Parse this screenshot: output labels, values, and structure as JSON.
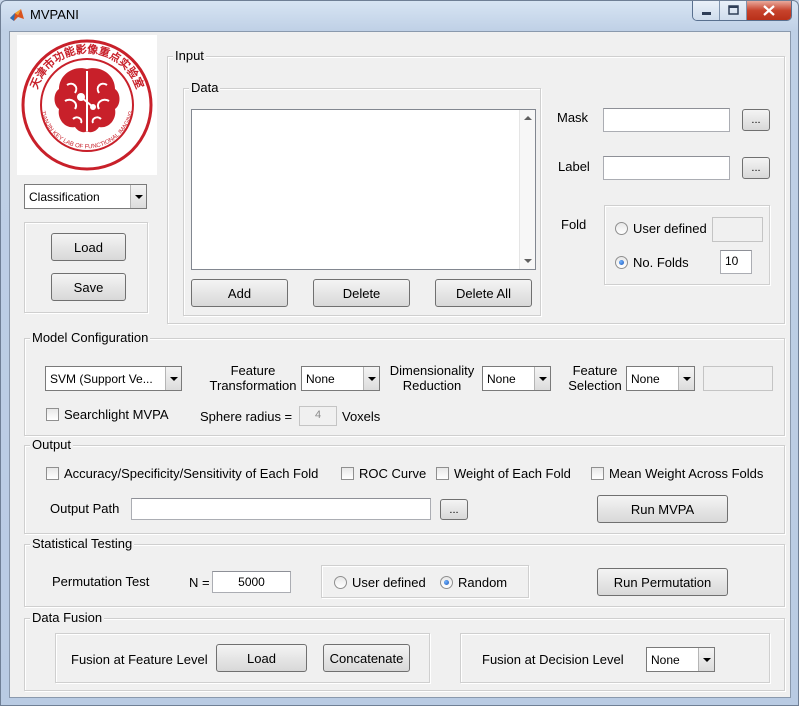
{
  "window": {
    "title": "MVPANI"
  },
  "logo": {
    "text_top": "天津市功能影像重点实验室",
    "text_bottom": "TIANJIN KEY LAB OF FUNCTIONAL IMAGING"
  },
  "mode_select": {
    "value": "Classification"
  },
  "side_buttons": {
    "load": "Load",
    "save": "Save"
  },
  "input": {
    "title": "Input",
    "data": {
      "title": "Data",
      "add": "Add",
      "delete": "Delete",
      "delete_all": "Delete All"
    },
    "mask": {
      "label": "Mask",
      "value": "",
      "browse": "..."
    },
    "label": {
      "label": "Label",
      "value": "",
      "browse": "..."
    },
    "fold": {
      "label": "Fold",
      "user_defined": "User defined",
      "user_defined_value": "",
      "no_folds": "No. Folds",
      "no_folds_value": "10",
      "selected": "no_folds"
    }
  },
  "model_config": {
    "title": "Model Configuration",
    "classifier": "SVM (Support Ve...",
    "feature_transformation": {
      "label_line1": "Feature",
      "label_line2": "Transformation",
      "value": "None"
    },
    "dimensionality_reduction": {
      "label_line1": "Dimensionality",
      "label_line2": "Reduction",
      "value": "None"
    },
    "feature_selection": {
      "label_line1": "Feature",
      "label_line2": "Selection",
      "value": "None",
      "param": ""
    },
    "searchlight": {
      "label": "Searchlight MVPA",
      "checked": false
    },
    "sphere_radius": {
      "label": "Sphere radius =",
      "value": "4",
      "unit": "Voxels"
    }
  },
  "output": {
    "title": "Output",
    "options": [
      {
        "label": "Accuracy/Specificity/Sensitivity of Each Fold",
        "checked": false
      },
      {
        "label": "ROC Curve",
        "checked": false
      },
      {
        "label": "Weight of Each Fold",
        "checked": false
      },
      {
        "label": "Mean Weight Across Folds",
        "checked": false
      }
    ],
    "path_label": "Output Path",
    "path_value": "",
    "browse": "...",
    "run": "Run MVPA"
  },
  "stats": {
    "title": "Statistical Testing",
    "permutation_label": "Permutation Test",
    "n_label": "N =",
    "n_value": "5000",
    "user_defined": "User defined",
    "random": "Random",
    "selected": "random",
    "run": "Run Permutation"
  },
  "fusion": {
    "title": "Data Fusion",
    "feature_level_label": "Fusion at Feature Level",
    "load": "Load",
    "concatenate": "Concatenate",
    "decision_level_label": "Fusion at Decision Level",
    "decision_value": "None"
  },
  "colors": {
    "window_frame": "#b9cbe3",
    "panel_bg": "#f0f0f0",
    "logo_red": "#c8202a",
    "radio_dot": "#1c56b8"
  }
}
